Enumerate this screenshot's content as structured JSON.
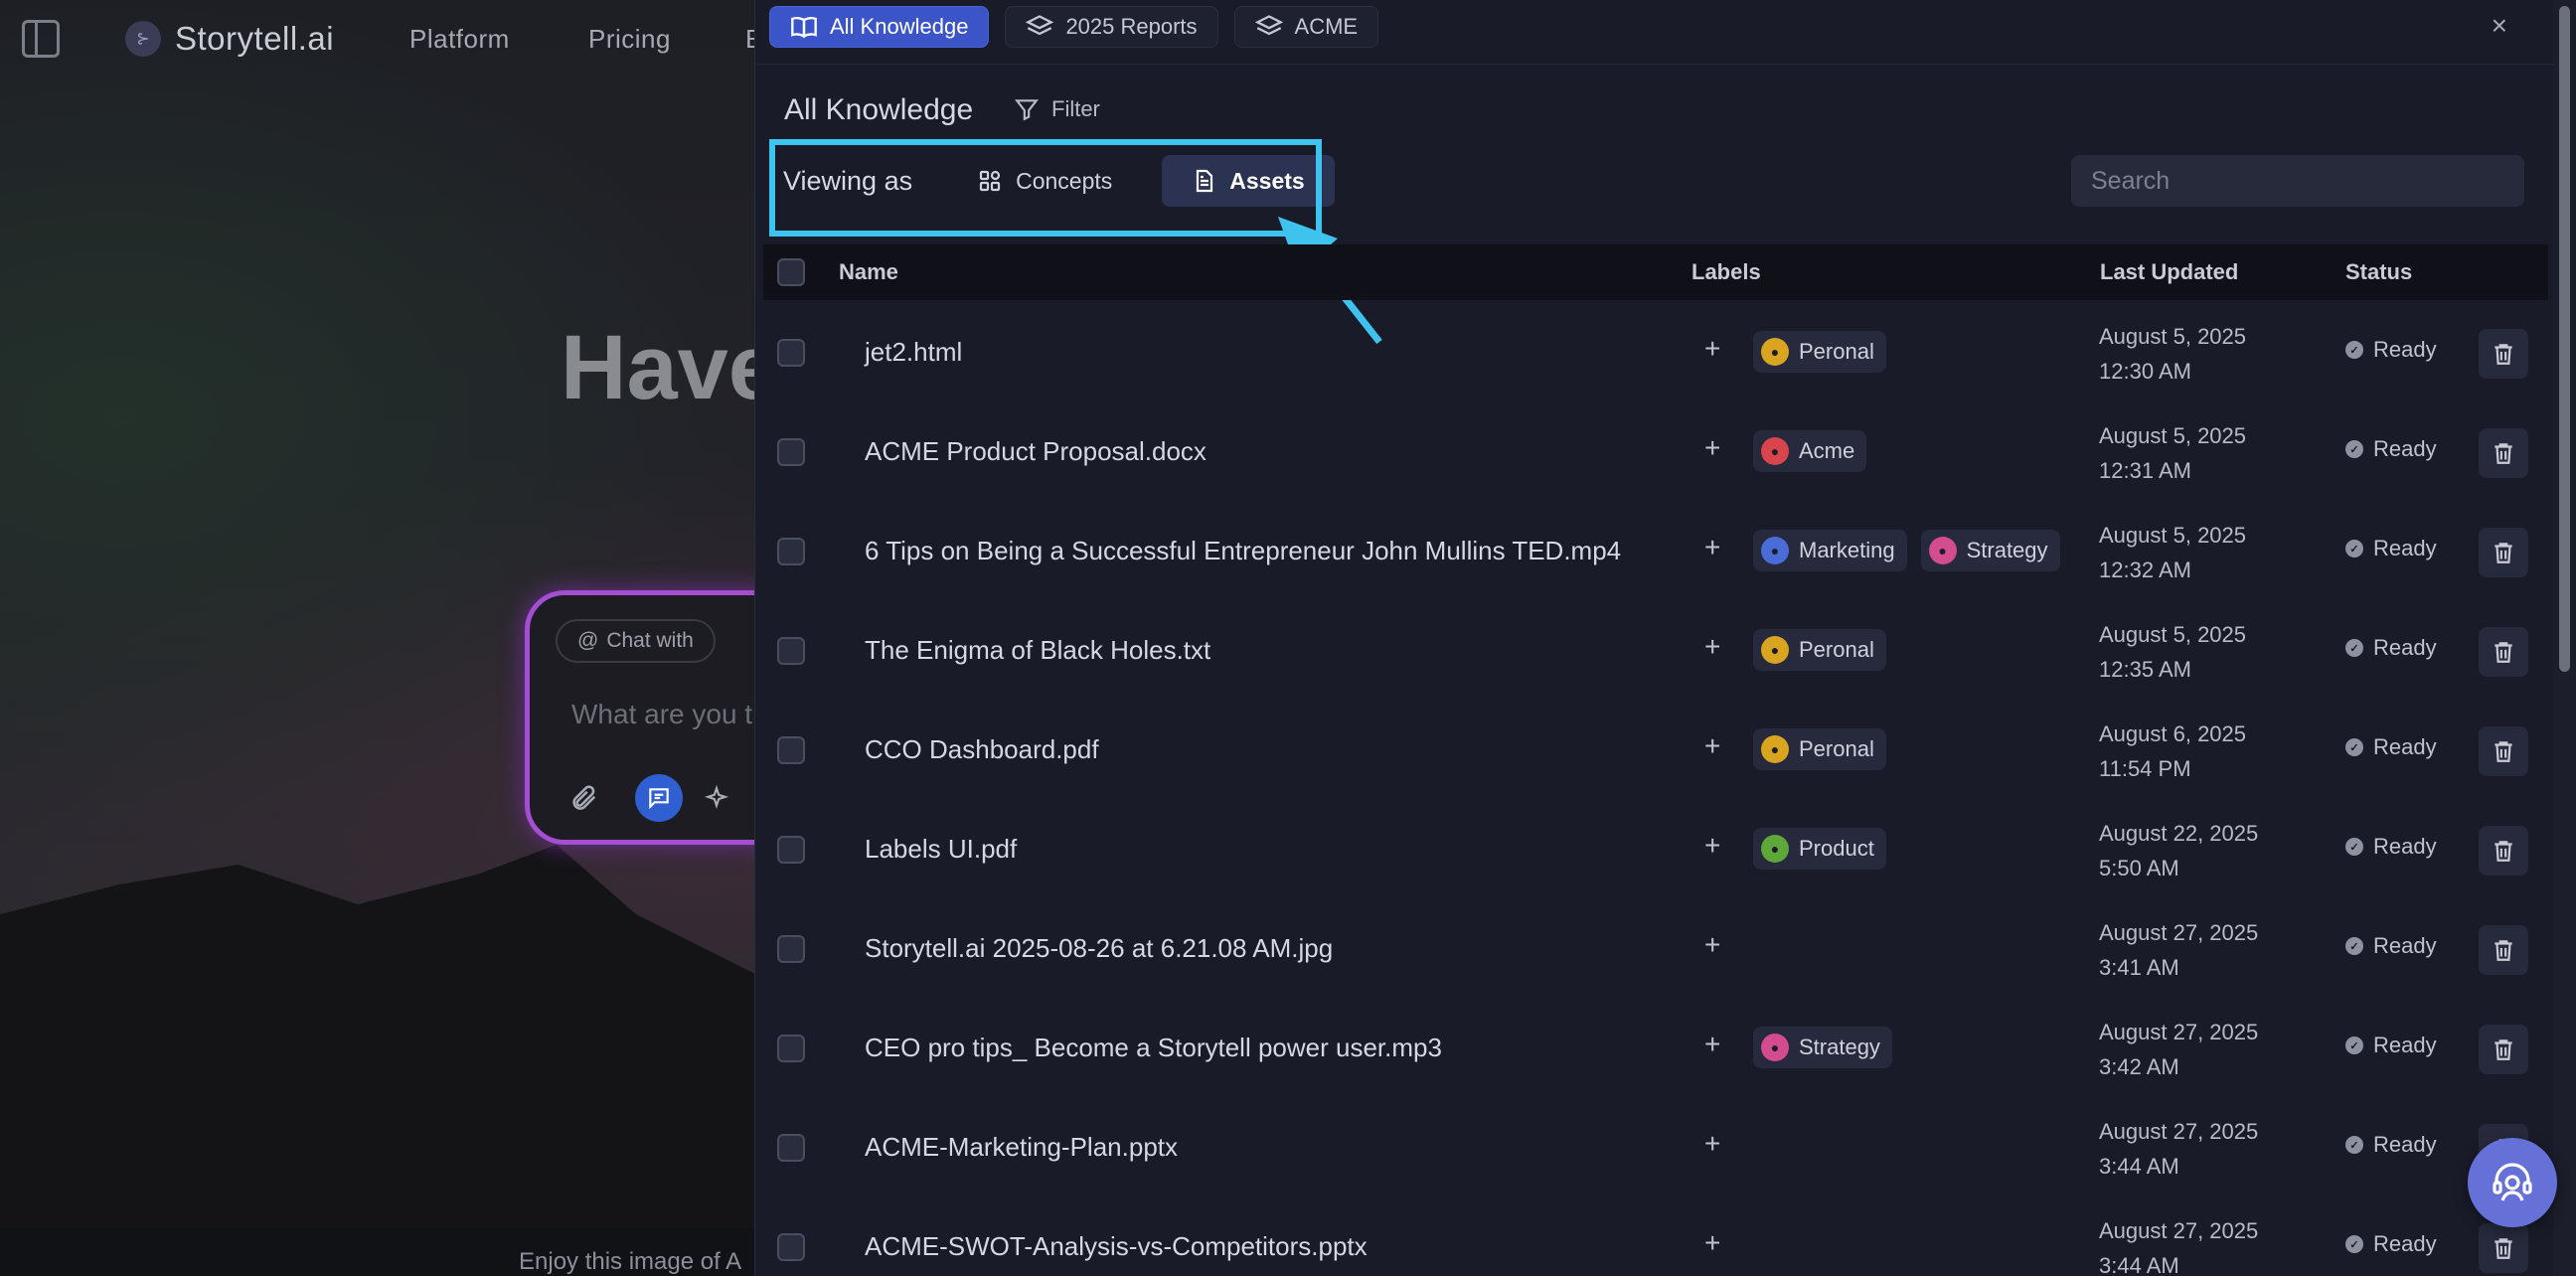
{
  "background": {
    "brand": "Storytell.ai",
    "nav": [
      "Platform",
      "Pricing",
      "E"
    ],
    "hero_text": "Have",
    "chat_chip": "Chat with",
    "chat_placeholder": "What are you t",
    "footer_text": "Enjoy this image of A"
  },
  "panel": {
    "tabs": [
      {
        "label": "All Knowledge",
        "icon": "book-icon",
        "active": true
      },
      {
        "label": "2025 Reports",
        "icon": "layers-icon",
        "active": false
      },
      {
        "label": "ACME",
        "icon": "layers-icon",
        "active": false
      }
    ],
    "close_icon": "×",
    "title": "All Knowledge",
    "filter_label": "Filter",
    "viewing_label": "Viewing as",
    "view_concepts": "Concepts",
    "view_assets": "Assets",
    "search_placeholder": "Search",
    "columns": {
      "name": "Name",
      "labels": "Labels",
      "updated": "Last Updated",
      "status": "Status"
    },
    "rows": [
      {
        "name": "jet2.html",
        "labels": [
          {
            "text": "Peronal",
            "color": "#d9a520"
          }
        ],
        "date": "August 5, 2025",
        "time": "12:30 AM",
        "status": "Ready"
      },
      {
        "name": "ACME Product Proposal.docx",
        "labels": [
          {
            "text": "Acme",
            "color": "#d8454d"
          }
        ],
        "date": "August 5, 2025",
        "time": "12:31 AM",
        "status": "Ready"
      },
      {
        "name": "6 Tips on Being a Successful Entrepreneur John Mullins TED.mp4",
        "labels": [
          {
            "text": "Marketing",
            "color": "#4a6cd6"
          },
          {
            "text": "Strategy",
            "color": "#d34c8f"
          }
        ],
        "date": "August 5, 2025",
        "time": "12:32 AM",
        "status": "Ready"
      },
      {
        "name": "The Enigma of Black Holes.txt",
        "labels": [
          {
            "text": "Peronal",
            "color": "#d9a520"
          }
        ],
        "date": "August 5, 2025",
        "time": "12:35 AM",
        "status": "Ready"
      },
      {
        "name": "CCO Dashboard.pdf",
        "labels": [
          {
            "text": "Peronal",
            "color": "#d9a520"
          }
        ],
        "date": "August 6, 2025",
        "time": "11:54 PM",
        "status": "Ready"
      },
      {
        "name": "Labels UI.pdf",
        "labels": [
          {
            "text": "Product",
            "color": "#5ea83a"
          }
        ],
        "date": "August 22, 2025",
        "time": "5:50 AM",
        "status": "Ready"
      },
      {
        "name": "Storytell.ai 2025-08-26 at 6.21.08 AM.jpg",
        "labels": [],
        "date": "August 27, 2025",
        "time": "3:41 AM",
        "status": "Ready"
      },
      {
        "name": "CEO pro tips_ Become a Storytell power user.mp3",
        "labels": [
          {
            "text": "Strategy",
            "color": "#d34c8f"
          }
        ],
        "date": "August 27, 2025",
        "time": "3:42 AM",
        "status": "Ready"
      },
      {
        "name": "ACME-Marketing-Plan.pptx",
        "labels": [],
        "date": "August 27, 2025",
        "time": "3:44 AM",
        "status": "Ready"
      },
      {
        "name": "ACME-SWOT-Analysis-vs-Competitors.pptx",
        "labels": [],
        "date": "August 27, 2025",
        "time": "3:44 AM",
        "status": "Ready"
      }
    ]
  },
  "colors": {
    "accent": "#3b55c9",
    "highlight": "#3ec3ee",
    "panel_bg": "#191b29",
    "help_fab": "#6671d8"
  }
}
